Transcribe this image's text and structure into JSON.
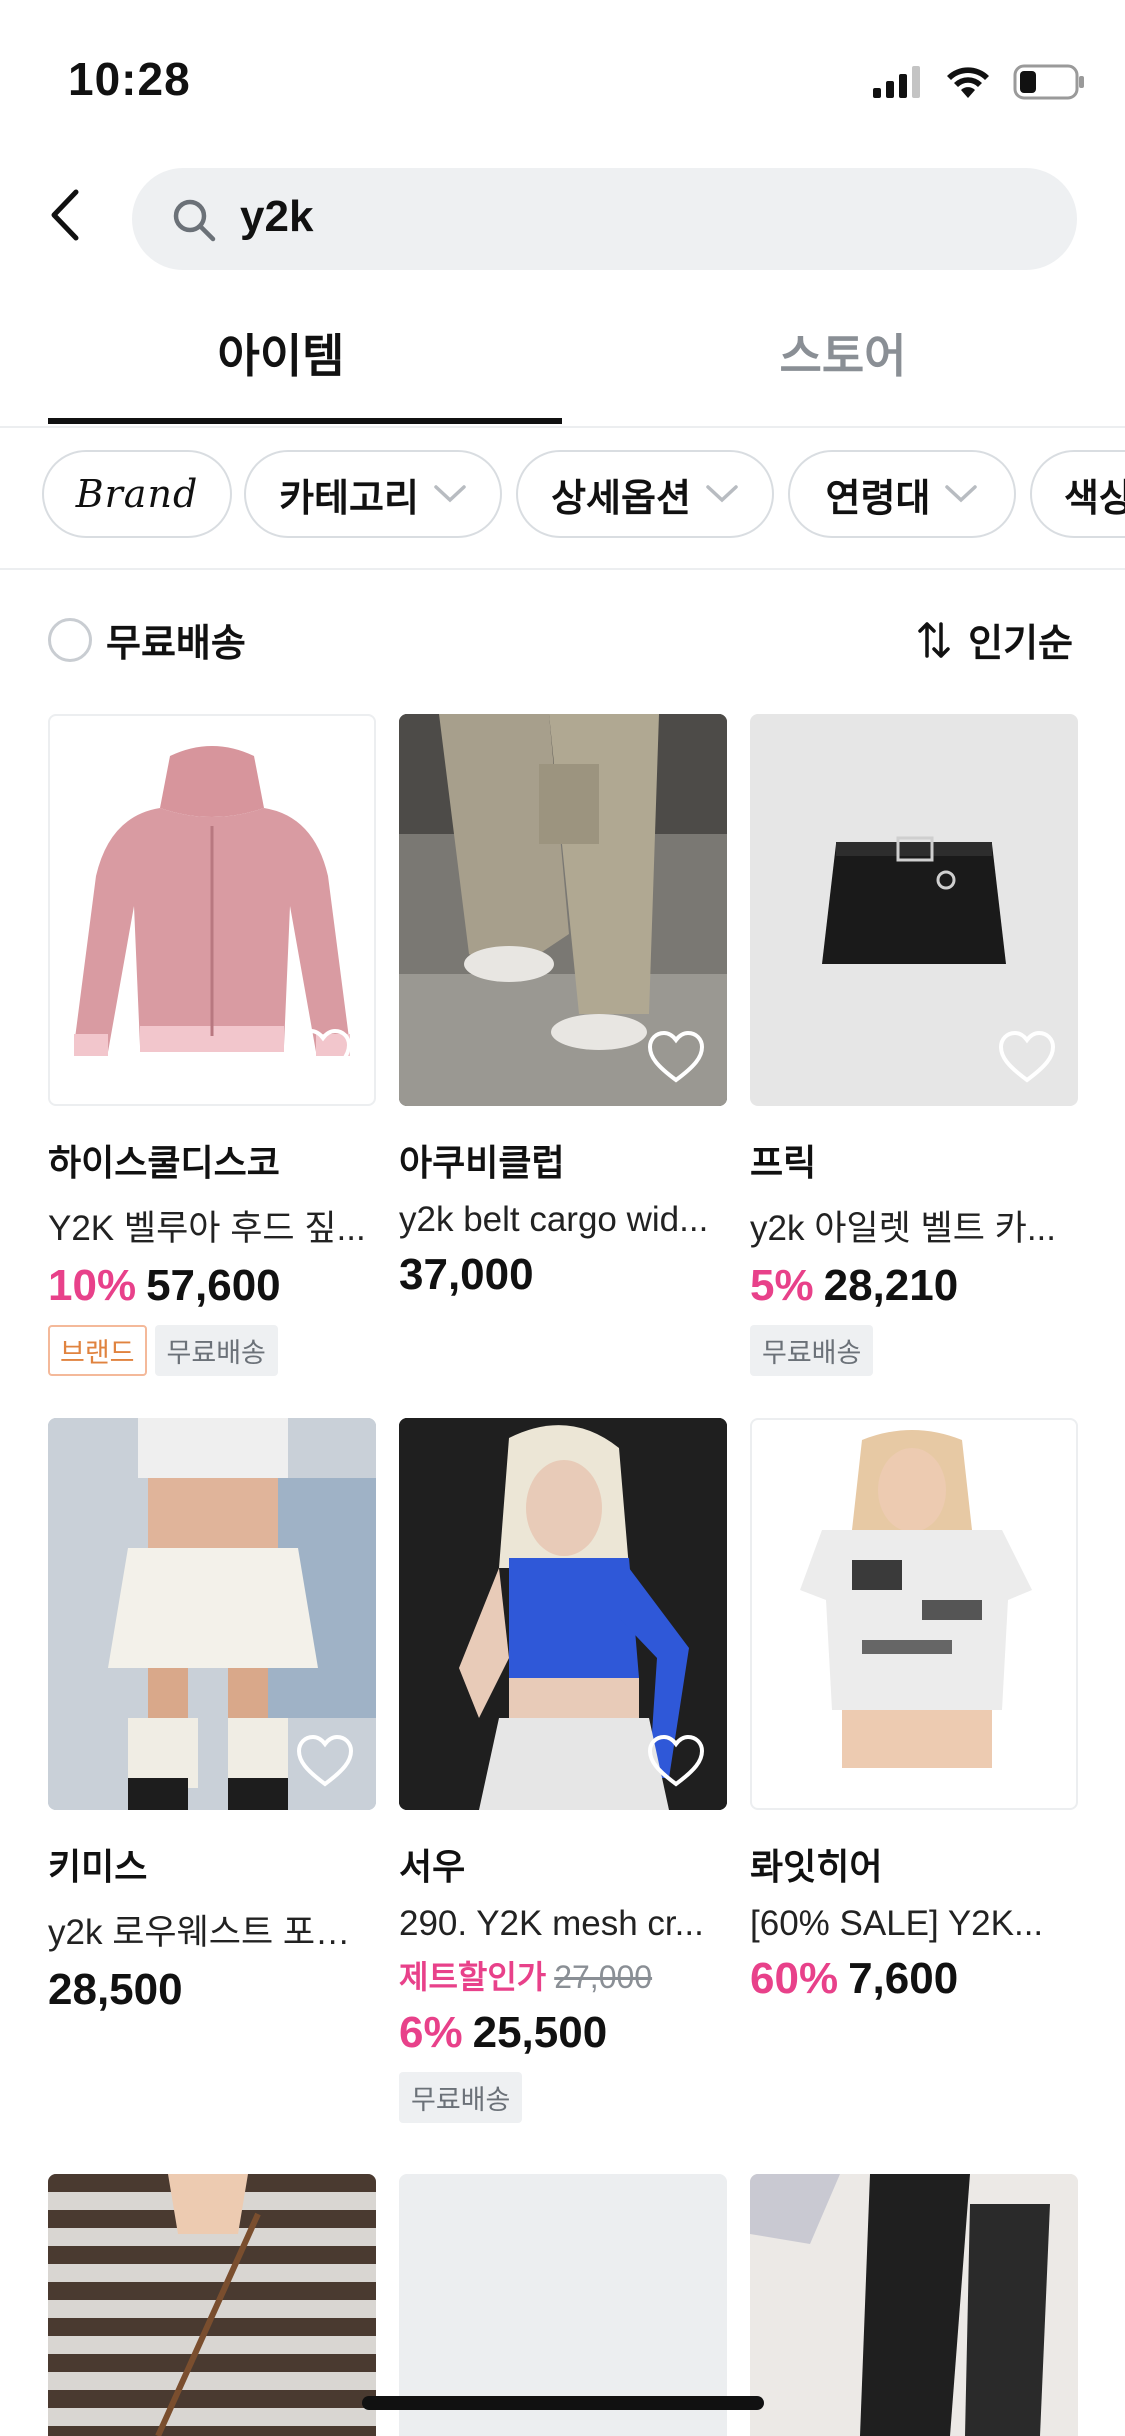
{
  "status_bar": {
    "time": "10:28"
  },
  "search": {
    "query": "y2k"
  },
  "tabs": [
    {
      "label": "아이템"
    },
    {
      "label": "스토어"
    }
  ],
  "filters": [
    {
      "label": "Brand"
    },
    {
      "label": "카테고리"
    },
    {
      "label": "상세옵션"
    },
    {
      "label": "연령대"
    },
    {
      "label": "색상"
    }
  ],
  "options": {
    "free_shipping": "무료배송",
    "sort": "인기순"
  },
  "products": [
    {
      "store": "하이스쿨디스코",
      "name": "Y2K 벨루아 후드 짚...",
      "discount": "10%",
      "price": "57,600",
      "badges": [
        "브랜드",
        "무료배송"
      ]
    },
    {
      "store": "아쿠비클럽",
      "name": "y2k belt cargo wid...",
      "discount": "",
      "price": "37,000",
      "badges": []
    },
    {
      "store": "프릭",
      "name": "y2k 아일렛 벨트 카...",
      "discount": "5%",
      "price": "28,210",
      "badges": [
        "무료배송"
      ]
    },
    {
      "store": "키미스",
      "name": "y2k 로우웨스트 포켓...",
      "discount": "",
      "price": "28,500",
      "badges": []
    },
    {
      "store": "서우",
      "name": " 290. Y2K mesh cr...",
      "zero_label": "제트할인가",
      "original_price": "27,000",
      "discount": "6%",
      "price": "25,500",
      "badges": [
        "무료배송"
      ]
    },
    {
      "store": "롸잇히어",
      "name": "[60% SALE] Y2K...",
      "discount": "60%",
      "price": "7,600",
      "badges": []
    }
  ],
  "colors": {
    "accent_pink": "#e8418a",
    "brand_badge": "#e0833f",
    "tab_active": "#111111"
  }
}
